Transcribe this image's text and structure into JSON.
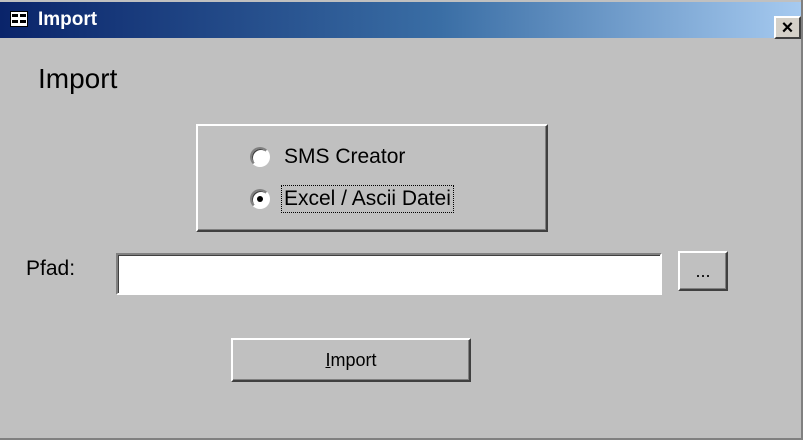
{
  "window": {
    "title": "Import",
    "close_label": "×",
    "icon": "form-icon",
    "colors": {
      "titlebar_start": "#0a246a",
      "titlebar_end": "#a6caf0",
      "face": "#c0c0c0"
    }
  },
  "form": {
    "heading": "Import",
    "options": [
      {
        "label": "SMS Creator",
        "selected": false
      },
      {
        "label": "Excel / Ascii Datei",
        "selected": true
      }
    ],
    "path": {
      "label": "Pfad:",
      "value": ""
    },
    "browse_label": "...",
    "import_button": {
      "mnemonic": "I",
      "rest": "mport"
    }
  }
}
